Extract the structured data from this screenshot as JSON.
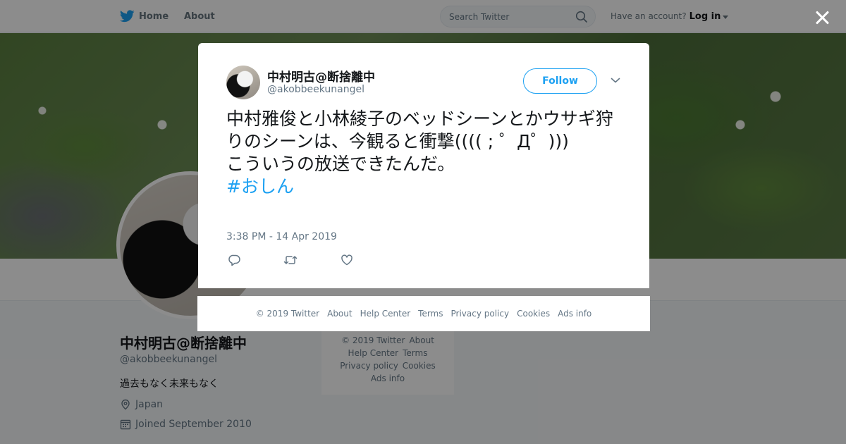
{
  "nav": {
    "home_label": "Home",
    "about_label": "About",
    "search_placeholder": "Search Twitter",
    "account_prompt": "Have an account?",
    "login_label": "Log in"
  },
  "profile": {
    "name": "中村明古@断捨離中",
    "handle": "@akobbeekunangel",
    "bio": "過去もなく未来もなく",
    "location": "Japan",
    "joined": "Joined September 2010"
  },
  "profile_footer": {
    "row1": [
      "© 2019 Twitter",
      "About"
    ],
    "row2": [
      "Help Center",
      "Terms"
    ],
    "row3": [
      "Privacy policy",
      "Cookies"
    ],
    "row4": [
      "Ads info"
    ]
  },
  "tweet": {
    "author_name": "中村明古@断捨離中",
    "author_handle": "@akobbeekunangel",
    "follow_label": "Follow",
    "text": "中村雅俊と小林綾子のベッドシーンとかウサギ狩りのシーンは、今観ると衝撃(((( ; ゜Д゜)))\nこういうの放送できたんだ。\n",
    "hashtag": "#おしん",
    "timestamp": "3:38 PM - 14 Apr 2019"
  },
  "modal_footer": {
    "links": [
      "© 2019 Twitter",
      "About",
      "Help Center",
      "Terms",
      "Privacy policy",
      "Cookies",
      "Ads info"
    ]
  },
  "colors": {
    "brand_blue": "#1da1f2",
    "text_primary": "#14171a",
    "text_secondary": "#657786"
  },
  "icons": [
    "twitter-bird-icon",
    "search-icon",
    "close-icon",
    "chevron-down-icon",
    "location-pin-icon",
    "calendar-icon",
    "reply-icon",
    "retweet-icon",
    "like-icon"
  ]
}
